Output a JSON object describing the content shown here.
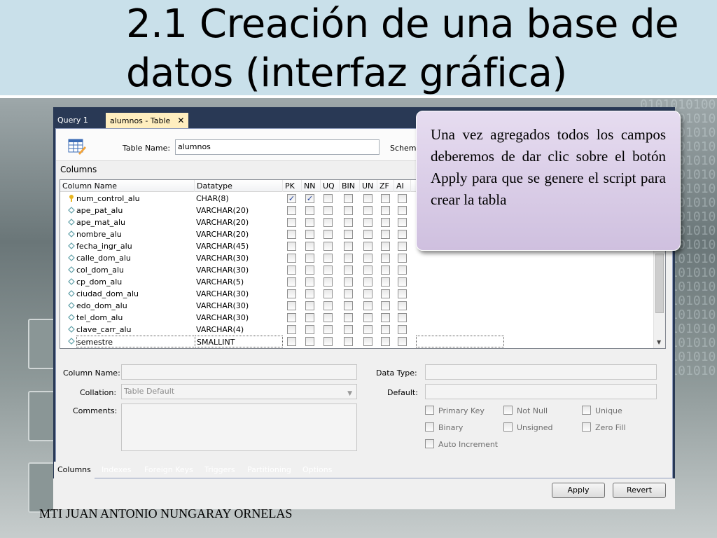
{
  "slide": {
    "title": "2.1 Creación de una base de datos (interfaz gráfica)",
    "footer": "MTI JUAN ANTONIO NUNGARAY ORNELAS",
    "callout": "Una vez agregados todos los campos deberemos de dar clic sobre el botón Apply para que se genere el script para crear la tabla",
    "binary_deco": "0101010100101010101010101010101010101010101010101010101010101010101010101010101010101010101010101010101010101010101010101010101010101010101010101010101010101010101010101010101010101010101010101010101010101010"
  },
  "tabs": {
    "query": "Query 1",
    "table": "alumnos - Table",
    "close": "✕"
  },
  "editor": {
    "table_name_label": "Table Name:",
    "table_name_value": "alumnos",
    "schema_label": "Schema",
    "columns_section": "Columns"
  },
  "grid": {
    "headers": {
      "column_name": "Column Name",
      "datatype": "Datatype",
      "pk": "PK",
      "nn": "NN",
      "uq": "UQ",
      "bin": "BIN",
      "un": "UN",
      "zf": "ZF",
      "ai": "AI"
    },
    "rows": [
      {
        "name": "num_control_alu",
        "type": "CHAR(8)",
        "icon": "key-icon",
        "pk": true,
        "nn": true
      },
      {
        "name": "ape_pat_alu",
        "type": "VARCHAR(20)",
        "icon": "diamond-icon",
        "pk": false,
        "nn": false
      },
      {
        "name": "ape_mat_alu",
        "type": "VARCHAR(20)",
        "icon": "diamond-icon",
        "pk": false,
        "nn": false
      },
      {
        "name": "nombre_alu",
        "type": "VARCHAR(20)",
        "icon": "diamond-icon",
        "pk": false,
        "nn": false
      },
      {
        "name": "fecha_ingr_alu",
        "type": "VARCHAR(45)",
        "icon": "diamond-icon",
        "pk": false,
        "nn": false
      },
      {
        "name": "calle_dom_alu",
        "type": "VARCHAR(30)",
        "icon": "diamond-icon",
        "pk": false,
        "nn": false
      },
      {
        "name": "col_dom_alu",
        "type": "VARCHAR(30)",
        "icon": "diamond-icon",
        "pk": false,
        "nn": false
      },
      {
        "name": "cp_dom_alu",
        "type": "VARCHAR(5)",
        "icon": "diamond-icon",
        "pk": false,
        "nn": false
      },
      {
        "name": "ciudad_dom_alu",
        "type": "VARCHAR(30)",
        "icon": "diamond-icon",
        "pk": false,
        "nn": false
      },
      {
        "name": "edo_dom_alu",
        "type": "VARCHAR(30)",
        "icon": "diamond-icon",
        "pk": false,
        "nn": false
      },
      {
        "name": "tel_dom_alu",
        "type": "VARCHAR(30)",
        "icon": "diamond-icon",
        "pk": false,
        "nn": false
      },
      {
        "name": "clave_carr_alu",
        "type": "VARCHAR(4)",
        "icon": "diamond-icon",
        "pk": false,
        "nn": false
      },
      {
        "name": "semestre",
        "type": "SMALLINT",
        "icon": "diamond-icon",
        "pk": false,
        "nn": false
      }
    ],
    "check_mark": "✓"
  },
  "details": {
    "column_name_label": "Column Name:",
    "collation_label": "Collation:",
    "collation_value": "Table Default",
    "comments_label": "Comments:",
    "data_type_label": "Data Type:",
    "default_label": "Default:",
    "primary_key": "Primary Key",
    "not_null": "Not Null",
    "unique": "Unique",
    "binary": "Binary",
    "unsigned": "Unsigned",
    "zero_fill": "Zero Fill",
    "auto_increment": "Auto Increment",
    "dropdown_arrow": "▼"
  },
  "bottom_tabs": [
    "Columns",
    "Indexes",
    "Foreign Keys",
    "Triggers",
    "Partitioning",
    "Options"
  ],
  "buttons": {
    "apply": "Apply",
    "revert": "Revert"
  },
  "scroll_arrow": "▼"
}
